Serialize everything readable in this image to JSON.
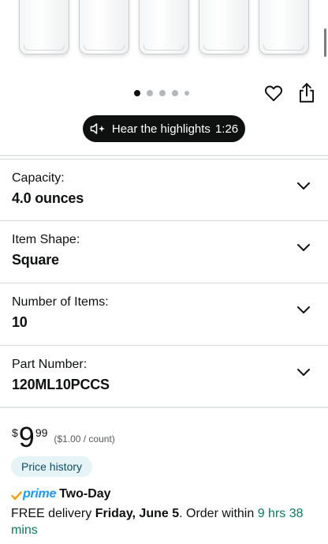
{
  "gallery": {
    "page_dots": 5,
    "active_dot": 0,
    "wishlist_icon": "heart-icon",
    "share_icon": "share-icon"
  },
  "highlights": {
    "label": "Hear the highlights",
    "duration": "1:26",
    "icon": "speaker-sparkle-icon"
  },
  "specs": [
    {
      "label": "Capacity:",
      "value": "4.0 ounces"
    },
    {
      "label": "Item Shape:",
      "value": "Square"
    },
    {
      "label": "Number of Items:",
      "value": "10"
    },
    {
      "label": "Part Number:",
      "value": "120ML10PCCS"
    }
  ],
  "price": {
    "currency": "$",
    "whole": "9",
    "fraction": "99",
    "unit_price": "($1.00 / count)"
  },
  "price_history_label": "Price history",
  "shipping": {
    "prime": "prime",
    "speed": "Two-Day",
    "free_delivery": "FREE delivery",
    "date": "Friday, June 5",
    "order_within": ". Order within",
    "countdown": "9 hrs 38 mins"
  },
  "colors": {
    "accent_prime": "#1a98ff",
    "countdown_green": "#067d62",
    "pill_bg": "#e6f3f7",
    "highlights_bg": "#0f1111"
  }
}
